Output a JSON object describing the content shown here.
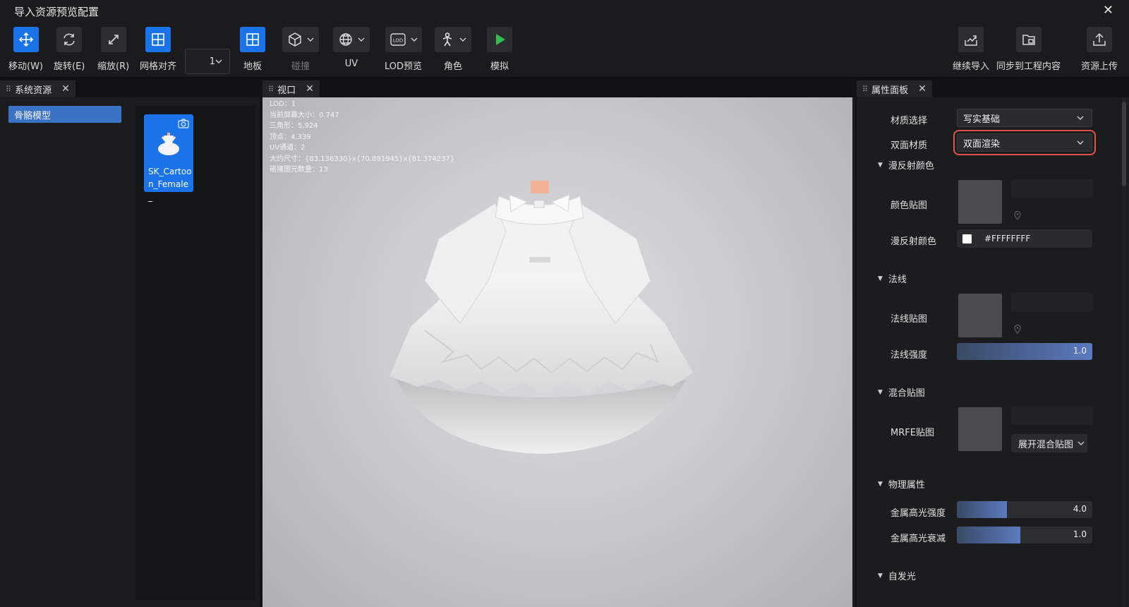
{
  "window": {
    "title": "导入资源预览配置",
    "close": "✕"
  },
  "toolbar": {
    "move": "移动(W)",
    "rotate": "旋转(E)",
    "scale": "缩放(R)",
    "grid_align": "网格对齐",
    "grid_value": "1",
    "floor": "地板",
    "collision": "碰撞",
    "uv": "UV",
    "lod_preview": "LOD预览",
    "role": "角色",
    "simulate": "模拟",
    "continue_import": "继续导入",
    "sync_project": "同步到工程内容",
    "upload": "资源上传"
  },
  "left_panel": {
    "tab": "系统资源",
    "tree_item": "骨骼模型",
    "asset_name": "SK_Cartoon_Female_"
  },
  "viewport": {
    "tab": "视口",
    "stats": [
      "LOD：1",
      "当前屏幕大小：0.747",
      "三角形：5,924",
      "顶点：4,339",
      "UV通道：2",
      "大约尺寸：{83.136330}x{70.891945}x{81.374237}",
      "碰撞图元数量：13"
    ]
  },
  "properties": {
    "tab": "属性面板",
    "material_select_label": "材质选择",
    "material_select_value": "写实基础",
    "double_sided_label": "双面材质",
    "double_sided_value": "双面渲染",
    "diffuse_section": "漫反射颜色",
    "color_map_label": "颜色贴图",
    "diffuse_color_label": "漫反射颜色",
    "diffuse_color_hex": "#FFFFFFFF",
    "normal_section": "法线",
    "normal_map_label": "法线贴图",
    "normal_strength_label": "法线强度",
    "normal_strength": "1.0",
    "normal_strength_fill": 1.0,
    "mix_section": "混合贴图",
    "mrfe_label": "MRFE贴图",
    "expand_mix_label": "展开混合贴图",
    "physics_section": "物理属性",
    "metal_spec_label": "金属高光强度",
    "metal_spec": "4.0",
    "metal_spec_fill": 0.37,
    "metal_decay_label": "金属高光衰减",
    "metal_decay": "1.0",
    "metal_decay_fill": 0.47,
    "emissive_section": "自发光"
  },
  "colors": {
    "accent": "#1a73e8",
    "highlight_border": "#e0524b",
    "play_green": "#2fbf4a"
  }
}
